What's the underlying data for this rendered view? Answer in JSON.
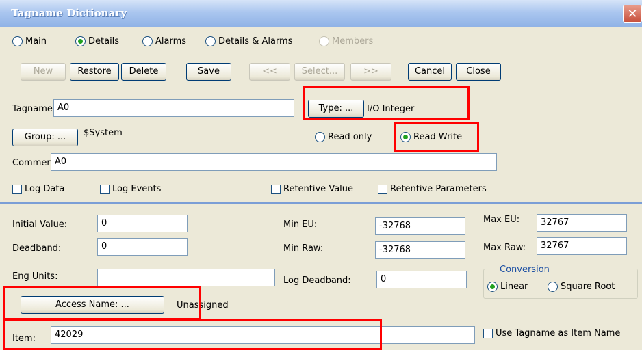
{
  "window": {
    "title": "Tagname Dictionary",
    "close_glyph": "✕"
  },
  "tabs": [
    {
      "label": "Main",
      "selected": false,
      "enabled": true
    },
    {
      "label": "Details",
      "selected": true,
      "enabled": true
    },
    {
      "label": "Alarms",
      "selected": false,
      "enabled": true
    },
    {
      "label": "Details & Alarms",
      "selected": false,
      "enabled": true
    },
    {
      "label": "Members",
      "selected": false,
      "enabled": false
    }
  ],
  "toolbar": {
    "new": "New",
    "restore": "Restore",
    "delete": "Delete",
    "save": "Save",
    "prev": "<<",
    "select": "Select...",
    "next": ">>",
    "cancel": "Cancel",
    "close": "Close"
  },
  "tag": {
    "tagname_label": "Tagname:",
    "tagname_value": "A0",
    "type_button": "Type: ...",
    "type_value": "I/O Integer",
    "group_button": "Group: ...",
    "group_value": "$System",
    "read_only": "Read only",
    "read_write": "Read Write",
    "access_mode": "Read Write",
    "comment_label": "Comment:",
    "comment_value": "A0",
    "log_data": "Log Data",
    "log_events": "Log Events",
    "retentive_value": "Retentive Value",
    "retentive_parameters": "Retentive Parameters"
  },
  "details": {
    "initial_value_label": "Initial Value:",
    "initial_value": "0",
    "deadband_label": "Deadband:",
    "deadband": "0",
    "eng_units_label": "Eng Units:",
    "eng_units": "",
    "min_eu_label": "Min EU:",
    "min_eu": "-32768",
    "min_raw_label": "Min Raw:",
    "min_raw": "-32768",
    "log_deadband_label": "Log Deadband:",
    "log_deadband": "0",
    "max_eu_label": "Max EU:",
    "max_eu": "32767",
    "max_raw_label": "Max Raw:",
    "max_raw": "32767",
    "conversion_label": "Conversion",
    "linear": "Linear",
    "square_root": "Square Root",
    "conversion": "Linear",
    "access_name_button": "Access Name: ...",
    "access_name_value": "Unassigned",
    "item_label": "Item:",
    "item_value": "42029",
    "use_tagname": "Use Tagname as Item Name"
  },
  "colors": {
    "highlight": "#ff0000",
    "titlebar": "#aac6ef",
    "separator": "#7b9ed6"
  }
}
